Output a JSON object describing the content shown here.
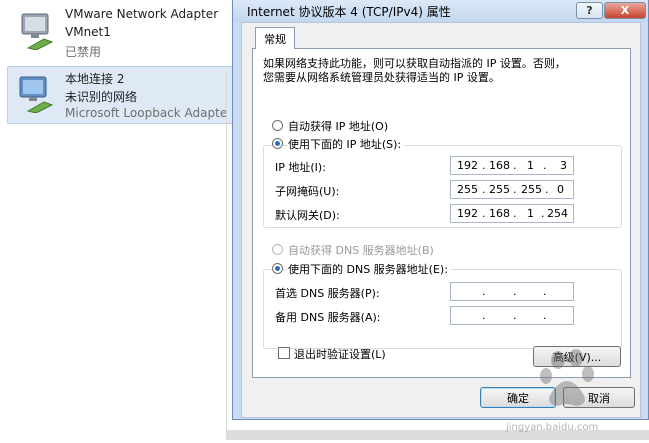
{
  "background": {
    "connections": [
      {
        "name": "VMware Network Adapter",
        "subname": "VMnet1",
        "status": "已禁用",
        "selected": false
      },
      {
        "name": "本地连接 2",
        "subname": "未识别的网络",
        "status": "Microsoft Loopback Adapte",
        "selected": true
      }
    ]
  },
  "dialog": {
    "title": "Internet 协议版本 4 (TCP/IPv4) 属性",
    "help_label": "?",
    "close_label": "X",
    "tab_label": "常规",
    "description_line1": "如果网络支持此功能，则可以获取自动指派的 IP 设置。否则，",
    "description_line2": "您需要从网络系统管理员处获得适当的 IP 设置。",
    "ip_auto_label": "自动获得 IP 地址(O)",
    "ip_manual_label": "使用下面的 IP 地址(S):",
    "ip_address_label": "IP 地址(I):",
    "ip_address": [
      "192",
      "168",
      "1",
      "3"
    ],
    "subnet_label": "子网掩码(U):",
    "subnet_mask": [
      "255",
      "255",
      "255",
      "0"
    ],
    "gateway_label": "默认网关(D):",
    "gateway": [
      "192",
      "168",
      "1",
      "254"
    ],
    "dns_auto_label": "自动获得 DNS 服务器地址(B)",
    "dns_manual_label": "使用下面的 DNS 服务器地址(E):",
    "preferred_dns_label": "首选 DNS 服务器(P):",
    "alternate_dns_label": "备用 DNS 服务器(A):",
    "validate_label": "退出时验证设置(L)",
    "advanced_label": "高级(V)...",
    "ok_label": "确定",
    "cancel_label": "取消",
    "accent": "#2b6fc2"
  },
  "watermark": {
    "text": "jingyan.baidu.com"
  }
}
